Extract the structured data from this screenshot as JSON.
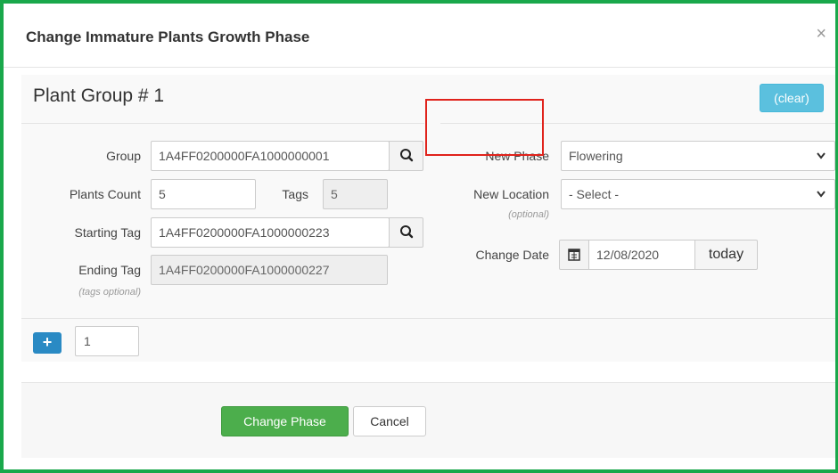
{
  "dialog": {
    "title": "Change Immature Plants Growth Phase",
    "close_glyph": "×"
  },
  "group": {
    "title": "Plant Group # 1",
    "clear_label": "(clear)",
    "fields": {
      "group_label": "Group",
      "group_value": "1A4FF0200000FA1000000001",
      "plants_count_label": "Plants Count",
      "plants_count_value": "5",
      "tags_label": "Tags",
      "tags_value": "5",
      "starting_tag_label": "Starting Tag",
      "starting_tag_value": "1A4FF0200000FA1000000223",
      "ending_tag_label": "Ending Tag",
      "ending_tag_value": "1A4FF0200000FA1000000227",
      "tags_optional_note": "(tags optional)"
    },
    "right": {
      "new_phase_label": "New Phase",
      "new_phase_value": "Flowering",
      "new_location_label": "New Location",
      "new_location_value": "- Select -",
      "optional_note": "(optional)",
      "change_date_label": "Change Date",
      "change_date_value": "12/08/2020",
      "today_label": "today"
    }
  },
  "add_groups": {
    "plus_glyph": "+",
    "count_value": "1"
  },
  "actions": {
    "primary_label": "Change Phase",
    "cancel_label": "Cancel"
  },
  "colors": {
    "frame_border": "#1aa84b",
    "highlight_border": "#e0231c",
    "clear_button": "#5bc0de",
    "primary_button": "#4cae4c",
    "plus_button": "#2a8ac4"
  },
  "icons": {
    "search": "search-icon",
    "calendar": "calendar-icon",
    "dropdown": "chevron-down-icon",
    "close": "close-icon",
    "plus": "plus-icon"
  }
}
